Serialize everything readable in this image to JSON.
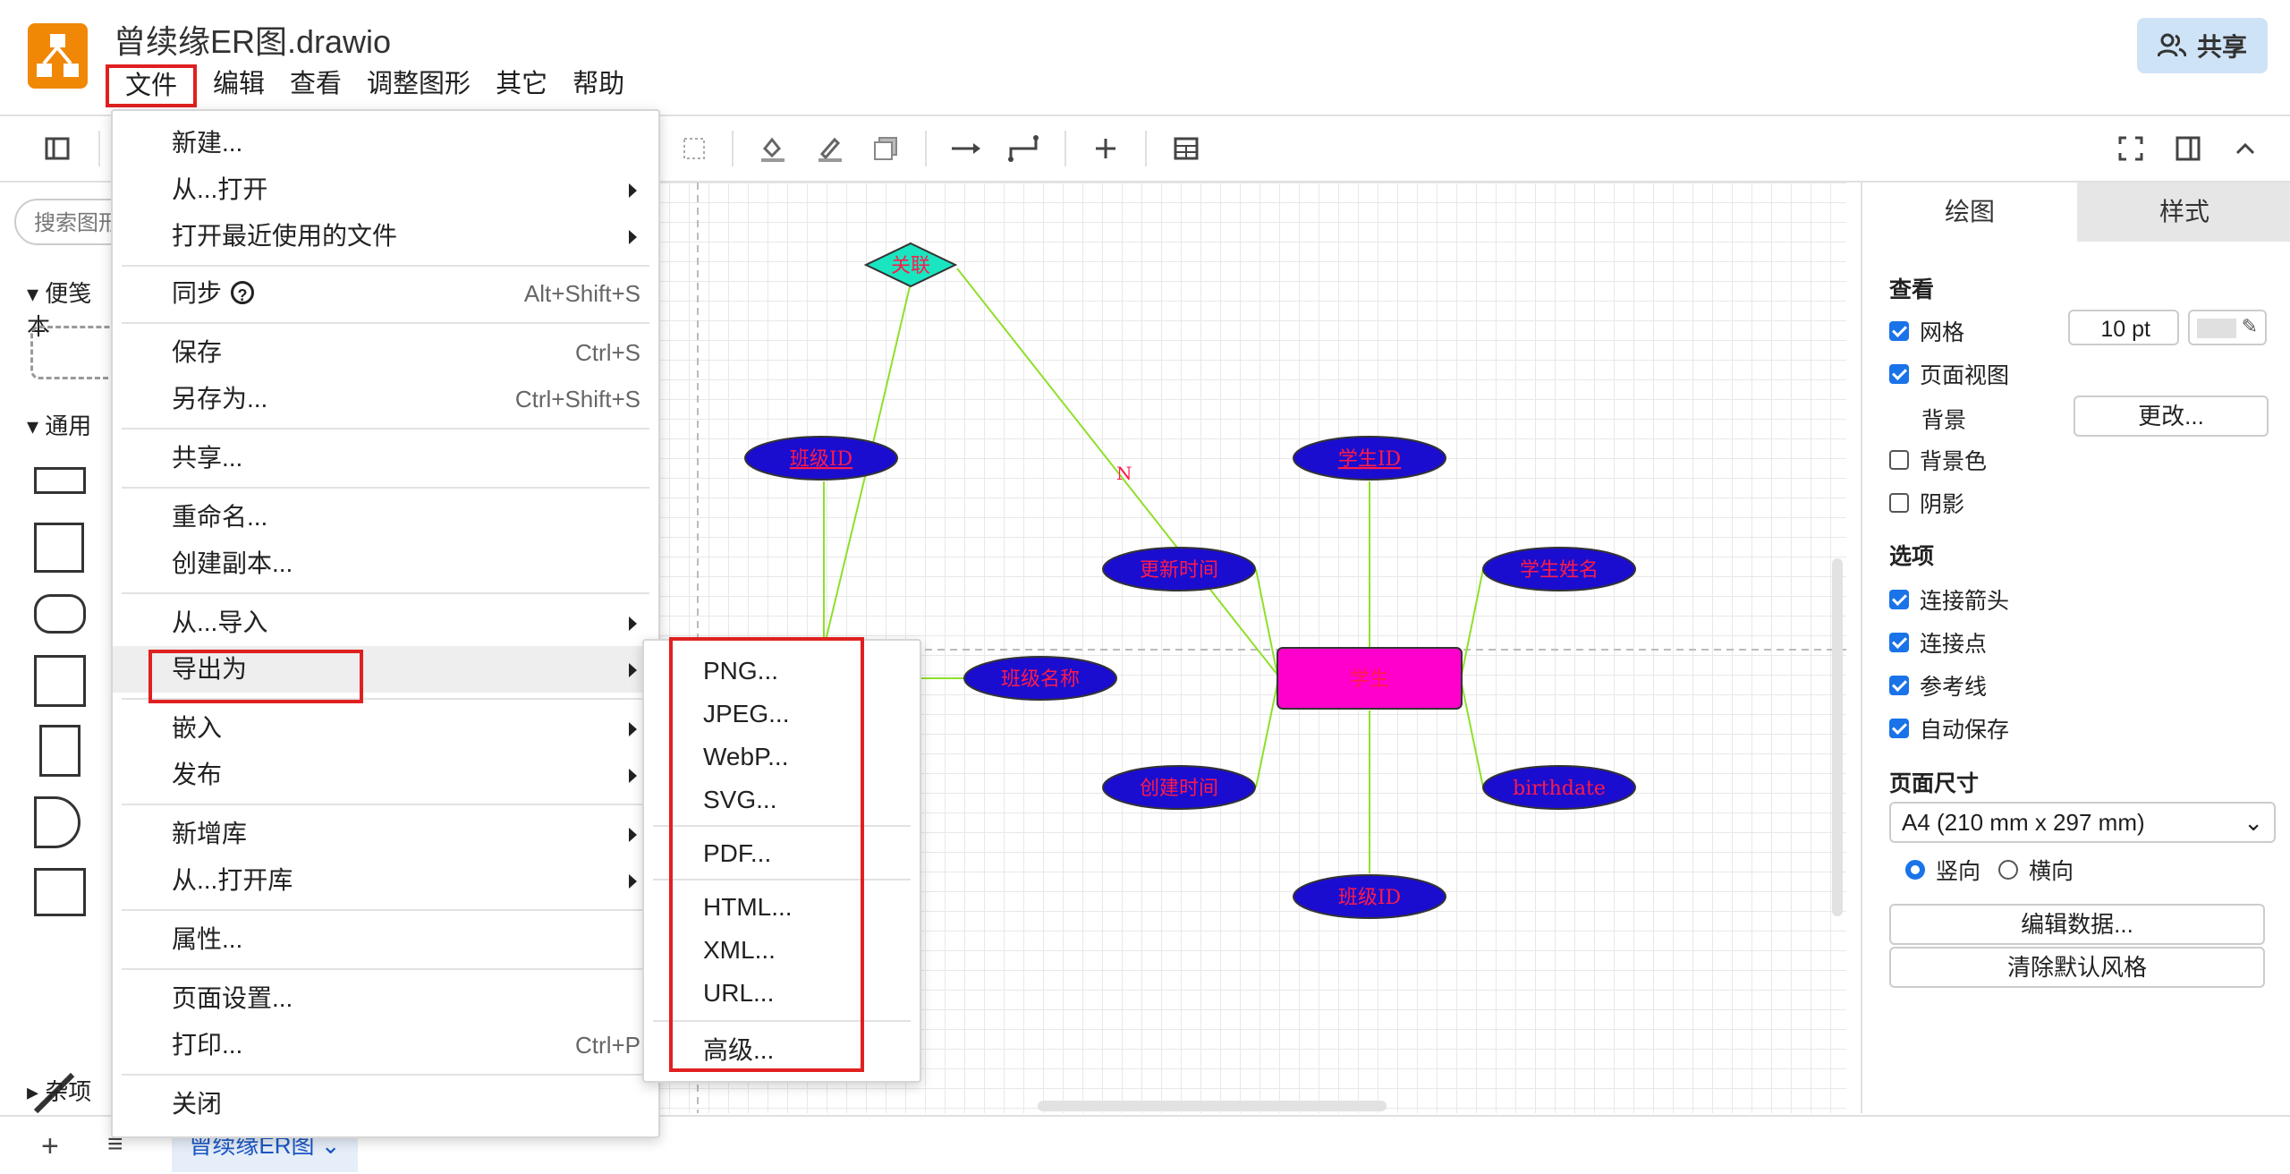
{
  "window": {
    "title": "曾续缘ER图.drawio"
  },
  "header": {
    "menus": [
      "文件",
      "编辑",
      "查看",
      "调整图形",
      "其它",
      "帮助"
    ],
    "share_label": "共享"
  },
  "left_panel": {
    "search_placeholder": "搜索图形",
    "sections": [
      "便笺本",
      "通用",
      "杂项"
    ]
  },
  "file_menu": {
    "items": [
      {
        "label": "新建...",
        "shortcut": "",
        "submenu": false
      },
      {
        "label": "从...打开",
        "shortcut": "",
        "submenu": true
      },
      {
        "label": "打开最近使用的文件",
        "shortcut": "",
        "submenu": true
      },
      {
        "label": "同步",
        "shortcut": "Alt+Shift+S",
        "submenu": false
      },
      {
        "label": "保存",
        "shortcut": "Ctrl+S",
        "submenu": false
      },
      {
        "label": "另存为...",
        "shortcut": "Ctrl+Shift+S",
        "submenu": false
      },
      {
        "label": "共享...",
        "shortcut": "",
        "submenu": false
      },
      {
        "label": "重命名...",
        "shortcut": "",
        "submenu": false
      },
      {
        "label": "创建副本...",
        "shortcut": "",
        "submenu": false
      },
      {
        "label": "从...导入",
        "shortcut": "",
        "submenu": true
      },
      {
        "label": "导出为",
        "shortcut": "",
        "submenu": true
      },
      {
        "label": "嵌入",
        "shortcut": "",
        "submenu": true
      },
      {
        "label": "发布",
        "shortcut": "",
        "submenu": true
      },
      {
        "label": "新增库",
        "shortcut": "",
        "submenu": true
      },
      {
        "label": "从...打开库",
        "shortcut": "",
        "submenu": true
      },
      {
        "label": "属性...",
        "shortcut": "",
        "submenu": false
      },
      {
        "label": "页面设置...",
        "shortcut": "",
        "submenu": false
      },
      {
        "label": "打印...",
        "shortcut": "Ctrl+P",
        "submenu": false
      },
      {
        "label": "关闭",
        "shortcut": "",
        "submenu": false
      }
    ]
  },
  "export_menu": {
    "items": [
      "PNG...",
      "JPEG...",
      "WebP...",
      "SVG...",
      "PDF...",
      "HTML...",
      "XML...",
      "URL...",
      "高级..."
    ]
  },
  "diagram": {
    "relation": "关联",
    "cardinality": "N",
    "entity": "学生",
    "attributes": {
      "class_id_left": "班级ID",
      "student_id": "学生ID",
      "update_time": "更新时间",
      "student_name": "学生姓名",
      "class_name": "班级名称",
      "create_time": "创建时间",
      "birthdate": "birthdate",
      "class_id_bottom": "班级ID"
    },
    "colors": {
      "entity": "#ff00cc",
      "attribute": "#1a0dcf",
      "relation": "#19e6c0",
      "edge": "#8ee02a",
      "text": "#ff1a4a"
    }
  },
  "right_panel": {
    "tabs": [
      "绘图",
      "样式"
    ],
    "view_header": "查看",
    "grid_label": "网格",
    "grid_size": "10 pt",
    "page_view_label": "页面视图",
    "background_label": "背景",
    "change_button": "更改...",
    "bg_color_label": "背景色",
    "shadow_label": "阴影",
    "options_header": "选项",
    "options": [
      "连接箭头",
      "连接点",
      "参考线",
      "自动保存"
    ],
    "page_size_header": "页面尺寸",
    "page_size_value": "A4 (210 mm x 297 mm)",
    "portrait_label": "竖向",
    "landscape_label": "横向",
    "edit_data_button": "编辑数据...",
    "clear_style_button": "清除默认风格"
  },
  "bottom_bar": {
    "page_tab": "曾续缘ER图"
  }
}
